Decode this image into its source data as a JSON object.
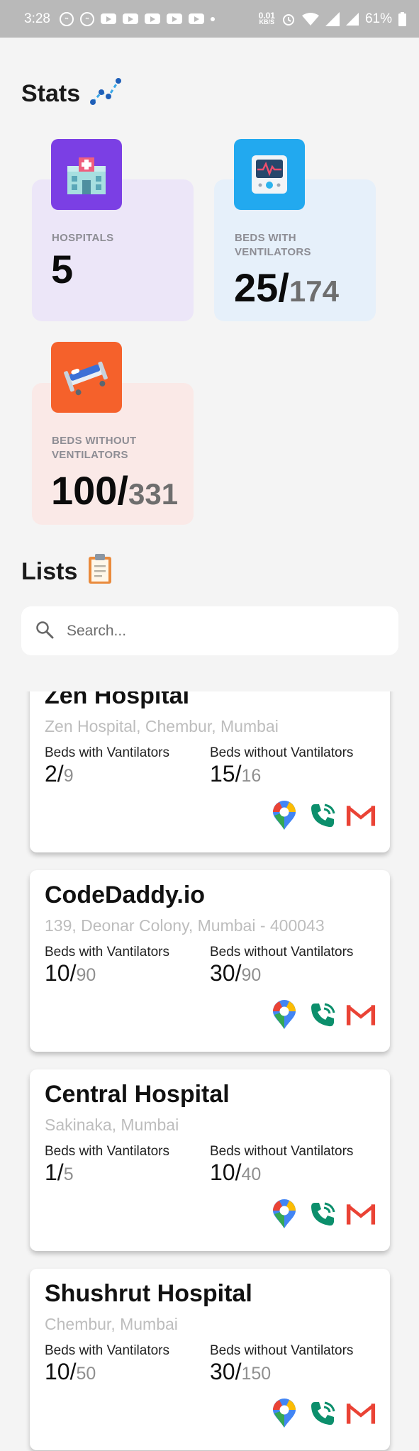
{
  "status_bar": {
    "time": "3:28",
    "speed_value": "0.01",
    "speed_unit": "KB/S",
    "battery_percent": "61%"
  },
  "stats": {
    "title": "Stats",
    "title_icon": "chart-trend-icon",
    "cards": [
      {
        "label": "HOSPITALS",
        "value": "5",
        "total": "",
        "icon": "hospital-icon",
        "icon_bg": "#7b3fe4",
        "card_bg": "#ece6f8"
      },
      {
        "label": "BEDS WITH VENTILATORS",
        "value": "25/",
        "total": "174",
        "icon": "ventilator-monitor-icon",
        "icon_bg": "#22a9ef",
        "card_bg": "#e6f0fa"
      },
      {
        "label": "BEDS WITHOUT VENTILATORS",
        "value": "100/",
        "total": "331",
        "icon": "hospital-bed-icon",
        "icon_bg": "#f5612b",
        "card_bg": "#fae9e7"
      }
    ]
  },
  "lists": {
    "title": "Lists",
    "title_icon": "clipboard-icon",
    "search_placeholder": "Search..."
  },
  "hospitals": [
    {
      "name": "Zen Hospital",
      "address": "Zen Hospital, Chembur, Mumbai",
      "vent_label": "Beds with Vantilators",
      "vent_value": "2/",
      "vent_total": "9",
      "nonvent_label": "Beds without Vantilators",
      "nonvent_value": "15/",
      "nonvent_total": "16"
    },
    {
      "name": "CodeDaddy.io",
      "address": "139, Deonar Colony, Mumbai - 400043",
      "vent_label": "Beds with Vantilators",
      "vent_value": "10/",
      "vent_total": "90",
      "nonvent_label": "Beds without Vantilators",
      "nonvent_value": "30/",
      "nonvent_total": "90"
    },
    {
      "name": "Central Hospital",
      "address": "Sakinaka, Mumbai",
      "vent_label": "Beds with Vantilators",
      "vent_value": "1/",
      "vent_total": "5",
      "nonvent_label": "Beds without Vantilators",
      "nonvent_value": "10/",
      "nonvent_total": "40"
    },
    {
      "name": "Shushrut Hospital",
      "address": "Chembur, Mumbai",
      "vent_label": "Beds with Vantilators",
      "vent_value": "10/",
      "vent_total": "50",
      "nonvent_label": "Beds without Vantilators",
      "nonvent_value": "30/",
      "nonvent_total": "150"
    }
  ],
  "actions": {
    "map": "google-maps-icon",
    "phone": "phone-call-icon",
    "mail": "gmail-icon"
  },
  "colors": {
    "background": "#f4f4f4",
    "status_bar": "#b9b9b9",
    "address_gray": "#bdbdbd",
    "phone_green": "#0c8f6c",
    "mail_red": "#ea4335"
  }
}
